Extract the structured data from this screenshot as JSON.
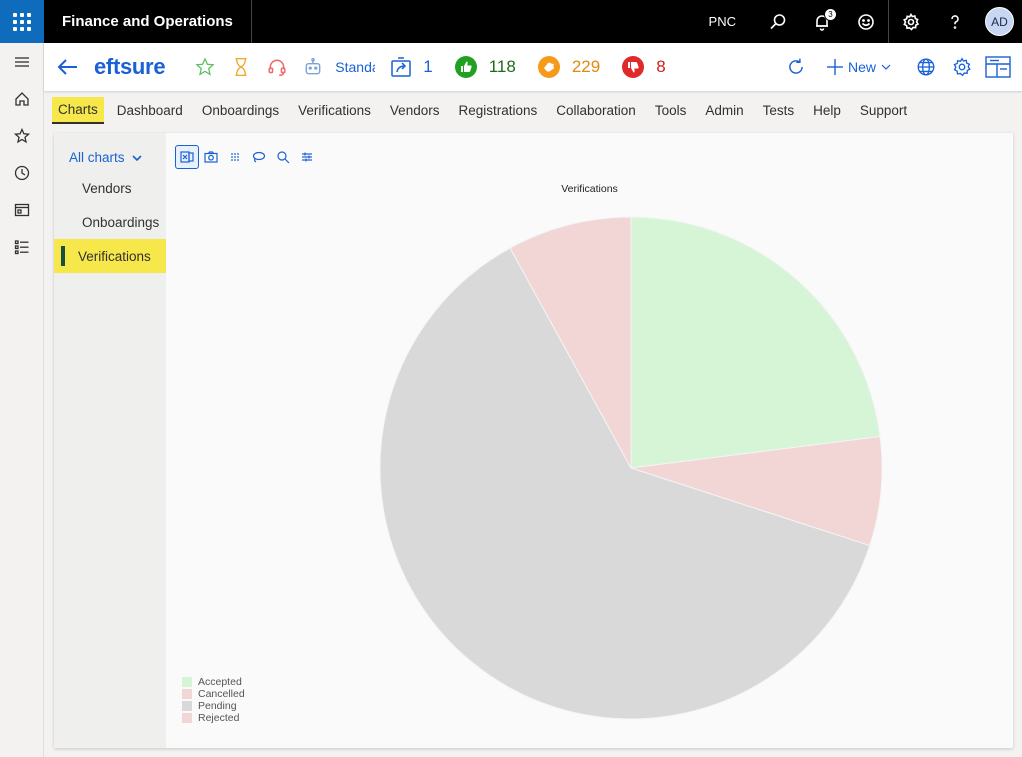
{
  "topbar": {
    "app_title": "Finance and Operations",
    "company": "PNC",
    "notifications_count": "3",
    "avatar_initials": "AD"
  },
  "header": {
    "logo": "eftsure",
    "standard_label": "Standard",
    "workspace_count": "1",
    "counters": [
      {
        "name": "approved",
        "value": "118",
        "color": "#1e8a1e",
        "icon": "thumbs-up-icon"
      },
      {
        "name": "pending",
        "value": "229",
        "color": "#f08a0c",
        "icon": "hand-icon"
      },
      {
        "name": "rejected",
        "value": "8",
        "color": "#d92626",
        "icon": "thumbs-down-icon"
      }
    ],
    "new_label": "New"
  },
  "menu": {
    "items": [
      "Charts",
      "Dashboard",
      "Onboardings",
      "Verifications",
      "Vendors",
      "Registrations",
      "Collaboration",
      "Tools",
      "Admin",
      "Tests",
      "Help",
      "Support"
    ],
    "active": "Charts"
  },
  "sidebar": {
    "header": "All charts",
    "items": [
      "Vendors",
      "Onboardings",
      "Verifications"
    ],
    "active": "Verifications"
  },
  "chart_data": {
    "type": "pie",
    "title": "Verifications",
    "categories": [
      "Accepted",
      "Cancelled",
      "Pending",
      "Rejected"
    ],
    "values": [
      23,
      7,
      62,
      8
    ],
    "colors": [
      "#d6f5d6",
      "#f2d6d6",
      "#d9d9d9",
      "#f2d6d6"
    ],
    "legend_position": "bottom-left"
  }
}
